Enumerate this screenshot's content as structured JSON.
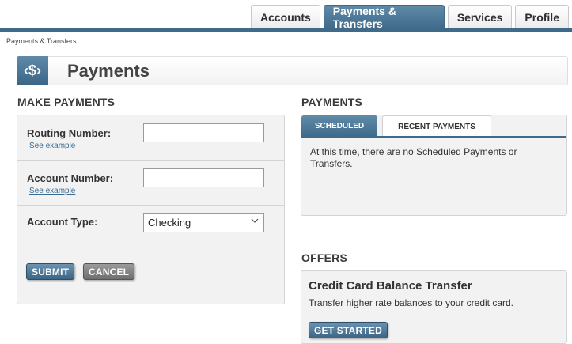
{
  "nav": {
    "tabs": [
      {
        "label": "Accounts"
      },
      {
        "label": "Payments & Transfers"
      },
      {
        "label": "Services"
      },
      {
        "label": "Profile"
      }
    ]
  },
  "breadcrumb": "Payments & Transfers",
  "page": {
    "icon_text": "‹$›",
    "title": "Payments"
  },
  "make_payments": {
    "heading": "MAKE PAYMENTS",
    "routing_label": "Routing Number:",
    "routing_value": "",
    "account_label": "Account Number:",
    "account_value": "",
    "see_example": "See example",
    "account_type_label": "Account Type:",
    "account_type_value": "Checking",
    "submit": "SUBMIT",
    "cancel": "CANCEL"
  },
  "payments": {
    "heading": "PAYMENTS",
    "tab_scheduled": "SCHEDULED",
    "tab_recent": "RECENT PAYMENTS",
    "message": "At this time, there are no Scheduled Payments or Transfers."
  },
  "offers": {
    "heading": "OFFERS",
    "title": "Credit Card Balance Transfer",
    "description": "Transfer higher rate balances to your credit card.",
    "button": "GET STARTED"
  },
  "colors": {
    "accent": "#3f6a8a",
    "link": "#3a6c93",
    "panel": "#f2f2f2"
  }
}
